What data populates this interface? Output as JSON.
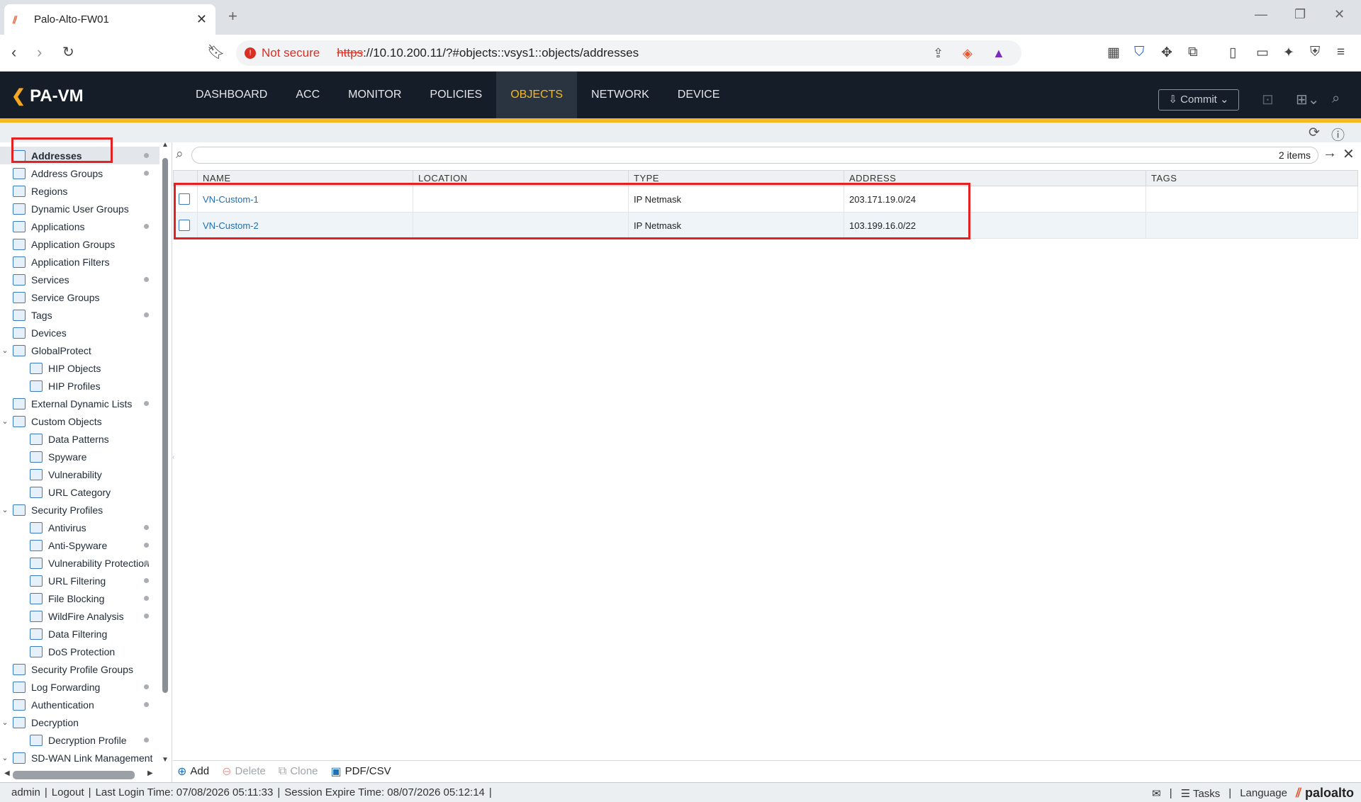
{
  "browser": {
    "tab_title": "Palo-Alto-FW01",
    "not_secure": "Not secure",
    "url_scheme": "https",
    "url_rest": "://10.10.200.11/?#objects::vsys1::objects/addresses"
  },
  "app": {
    "logo": "PA-VM",
    "nav": [
      "DASHBOARD",
      "ACC",
      "MONITOR",
      "POLICIES",
      "OBJECTS",
      "NETWORK",
      "DEVICE"
    ],
    "active_nav": "OBJECTS",
    "commit_label": "Commit"
  },
  "sidebar": {
    "items": [
      {
        "label": "Addresses",
        "level": 0,
        "dot": true,
        "selected": true
      },
      {
        "label": "Address Groups",
        "level": 0,
        "dot": true
      },
      {
        "label": "Regions",
        "level": 0,
        "dot": false
      },
      {
        "label": "Dynamic User Groups",
        "level": 0,
        "dot": false
      },
      {
        "label": "Applications",
        "level": 0,
        "dot": true
      },
      {
        "label": "Application Groups",
        "level": 0,
        "dot": false
      },
      {
        "label": "Application Filters",
        "level": 0,
        "dot": false
      },
      {
        "label": "Services",
        "level": 0,
        "dot": true
      },
      {
        "label": "Service Groups",
        "level": 0,
        "dot": false
      },
      {
        "label": "Tags",
        "level": 0,
        "dot": true
      },
      {
        "label": "Devices",
        "level": 0,
        "dot": false
      },
      {
        "label": "GlobalProtect",
        "level": 0,
        "dot": false,
        "expanded": true
      },
      {
        "label": "HIP Objects",
        "level": 1,
        "dot": false
      },
      {
        "label": "HIP Profiles",
        "level": 1,
        "dot": false
      },
      {
        "label": "External Dynamic Lists",
        "level": 0,
        "dot": true
      },
      {
        "label": "Custom Objects",
        "level": 0,
        "dot": false,
        "expanded": true
      },
      {
        "label": "Data Patterns",
        "level": 1,
        "dot": false
      },
      {
        "label": "Spyware",
        "level": 1,
        "dot": false
      },
      {
        "label": "Vulnerability",
        "level": 1,
        "dot": false
      },
      {
        "label": "URL Category",
        "level": 1,
        "dot": false
      },
      {
        "label": "Security Profiles",
        "level": 0,
        "dot": false,
        "expanded": true
      },
      {
        "label": "Antivirus",
        "level": 1,
        "dot": true
      },
      {
        "label": "Anti-Spyware",
        "level": 1,
        "dot": true
      },
      {
        "label": "Vulnerability Protection",
        "level": 1,
        "dot": true
      },
      {
        "label": "URL Filtering",
        "level": 1,
        "dot": true
      },
      {
        "label": "File Blocking",
        "level": 1,
        "dot": true
      },
      {
        "label": "WildFire Analysis",
        "level": 1,
        "dot": true
      },
      {
        "label": "Data Filtering",
        "level": 1,
        "dot": false
      },
      {
        "label": "DoS Protection",
        "level": 1,
        "dot": false
      },
      {
        "label": "Security Profile Groups",
        "level": 0,
        "dot": false
      },
      {
        "label": "Log Forwarding",
        "level": 0,
        "dot": true
      },
      {
        "label": "Authentication",
        "level": 0,
        "dot": true
      },
      {
        "label": "Decryption",
        "level": 0,
        "dot": false,
        "expanded": true
      },
      {
        "label": "Decryption Profile",
        "level": 1,
        "dot": true
      },
      {
        "label": "SD-WAN Link Management",
        "level": 0,
        "dot": false,
        "expanded": true
      }
    ]
  },
  "search": {
    "count": "2 items",
    "value": ""
  },
  "table": {
    "headers": [
      "NAME",
      "LOCATION",
      "TYPE",
      "ADDRESS",
      "TAGS"
    ],
    "rows": [
      {
        "name": "VN-Custom-1",
        "location": "",
        "type": "IP Netmask",
        "address": "203.171.19.0/24",
        "tags": ""
      },
      {
        "name": "VN-Custom-2",
        "location": "",
        "type": "IP Netmask",
        "address": "103.199.16.0/22",
        "tags": ""
      }
    ]
  },
  "actions": {
    "add": "Add",
    "delete": "Delete",
    "clone": "Clone",
    "pdf": "PDF/CSV"
  },
  "status": {
    "user": "admin",
    "logout": "Logout",
    "last_login": "Last Login Time: 07/08/2026 05:11:33",
    "session_expire": "Session Expire Time: 08/07/2026 05:12:14",
    "tasks": "Tasks",
    "language": "Language",
    "brand": "paloalto"
  },
  "colors": {
    "accent": "#f5b820",
    "header_bg": "#151d28",
    "link": "#1e6fb8",
    "highlight": "#e32121"
  }
}
